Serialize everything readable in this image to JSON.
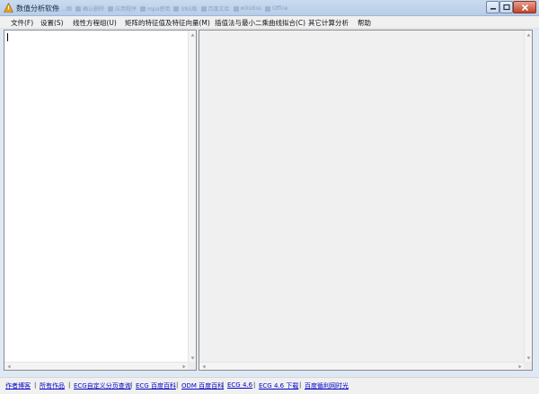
{
  "window": {
    "title": "数值分析软件",
    "ghost_tabs": [
      "…图",
      "确认删除",
      "应用程序",
      "mpa使用",
      "SNS版",
      "百度文库",
      "wikidiss",
      "Office"
    ]
  },
  "menu": [
    "文件(F)",
    "设置(S)",
    "线性方程组(U)",
    "矩阵的特征值及特征向量(M)",
    "插值法与最小二乘曲线拟合(C)",
    "其它计算分析",
    "帮助"
  ],
  "status_links": [
    "作者博客",
    "所有作品",
    "ECG自定义分页查询",
    "ECG 百度百科",
    "ODM 百度百科",
    "ECG 4.6",
    "ECG 4.6 下载",
    "百度循利网时光"
  ],
  "separator": "|",
  "colors": {
    "titlebar": "#b7cde8",
    "close_button": "#c4432b",
    "link": "#0000cc"
  }
}
